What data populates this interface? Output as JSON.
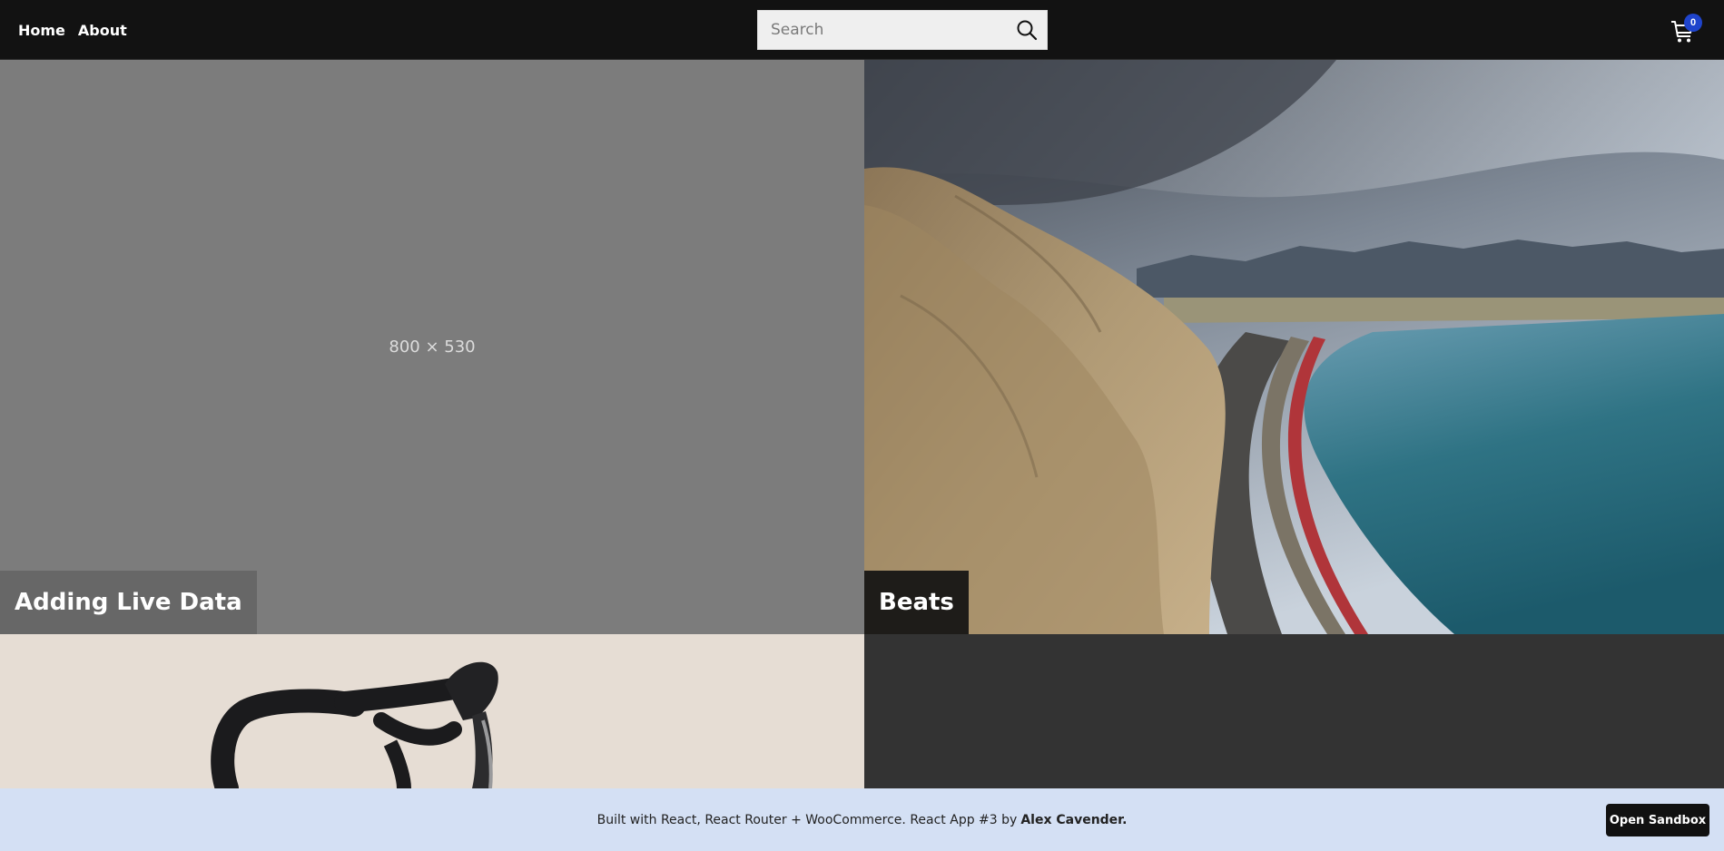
{
  "nav": {
    "home_label": "Home",
    "about_label": "About"
  },
  "search": {
    "placeholder": "Search",
    "icon": "search-icon"
  },
  "cart": {
    "icon": "cart-icon",
    "count": "0",
    "badge_color": "#1f44cc"
  },
  "tiles": [
    {
      "title": "Adding Live Data",
      "placeholder_text": "800 × 530"
    },
    {
      "title": "Beats"
    },
    {
      "title": ""
    }
  ],
  "footer": {
    "text": "Built with React, React Router + WooCommerce. React App #3 by",
    "author": "Alex Cavender.",
    "button_label": "Open Sandbox"
  },
  "colors": {
    "header_bg": "#121212",
    "placeholder_bg": "#7c7c7c",
    "footer_bg": "#d4e0f4",
    "page_bg": "#333333"
  }
}
